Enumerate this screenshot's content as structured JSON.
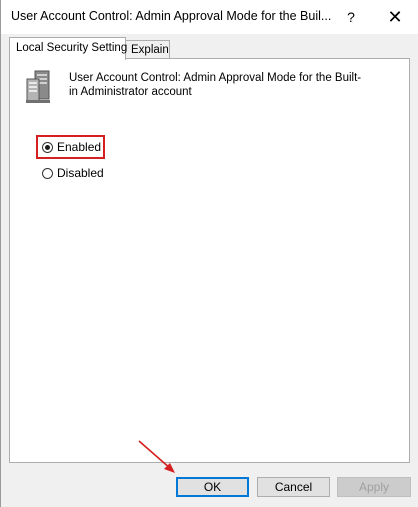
{
  "window": {
    "title": "User Account Control: Admin Approval Mode for the Buil...",
    "help_label": "?",
    "close_label": "✕"
  },
  "tabs": [
    {
      "label": "Local Security Setting",
      "active": true
    },
    {
      "label": "Explain",
      "active": false
    }
  ],
  "policy": {
    "icon": "server-icon",
    "title": "User Account Control: Admin Approval Mode for the Built-in Administrator account"
  },
  "options": {
    "enabled_label": "Enabled",
    "disabled_label": "Disabled",
    "selected": "Enabled"
  },
  "buttons": {
    "ok": "OK",
    "cancel": "Cancel",
    "apply": "Apply"
  },
  "colors": {
    "highlight": "#d42020",
    "accent": "#0078d7"
  }
}
